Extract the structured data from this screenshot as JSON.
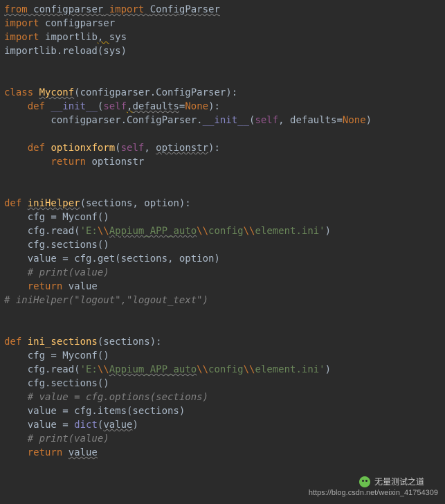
{
  "code": {
    "l1": {
      "a": "from ",
      "b": "configparser",
      "c": " import ",
      "d": "ConfigParser"
    },
    "l2": {
      "a": "import ",
      "b": "configparser"
    },
    "l3": {
      "a": "import ",
      "b": "importlib",
      "c": ", ",
      "d": "sys"
    },
    "l4": {
      "a": "importlib.reload(sys)"
    },
    "l5": "",
    "l6": "",
    "l7": {
      "a": "class ",
      "b": "Myconf",
      "c": "(configparser.ConfigParser):"
    },
    "l8": {
      "a": "    def ",
      "b": "__init__",
      "c": "(",
      "d": "self",
      "e": ",",
      "f": "defaults",
      "g": "=",
      "h": "None",
      "i": "):"
    },
    "l9": {
      "a": "        configparser.ConfigParser.",
      "b": "__init__",
      "c": "(",
      "d": "self",
      "e": ", ",
      "f": "defaults",
      "g": "=",
      "h": "None",
      "i": ")"
    },
    "l10": "",
    "l11": {
      "a": "    def ",
      "b": "optionxform",
      "c": "(",
      "d": "self",
      "e": ", ",
      "f": "optionstr",
      "g": "):"
    },
    "l12": {
      "a": "        return ",
      "b": "optionstr"
    },
    "l13": "",
    "l14": "",
    "l15": {
      "a": "def ",
      "b": "iniHelper",
      "c": "(sections, option):"
    },
    "l16": {
      "a": "    cfg = Myconf()"
    },
    "l17": {
      "a": "    cfg.read(",
      "b": "'E:",
      "c": "\\\\",
      "d": "Appium_APP_auto",
      "e": "\\\\",
      "f": "config",
      "g": "\\\\",
      "h": "element.ini'",
      "i": ")"
    },
    "l18": {
      "a": "    cfg.sections()"
    },
    "l19": {
      "a": "    value = cfg.get(sections, option)"
    },
    "l20": {
      "a": "    # print(value)"
    },
    "l21": {
      "a": "    return ",
      "b": "value"
    },
    "l22": {
      "a": "# iniHelper(\"logout\",\"logout_text\")"
    },
    "l23": "",
    "l24": "",
    "l25": {
      "a": "def ",
      "b": "ini_sections",
      "c": "(sections):"
    },
    "l26": {
      "a": "    cfg = Myconf()"
    },
    "l27": {
      "a": "    cfg.read(",
      "b": "'E:",
      "c": "\\\\",
      "d": "Appium_APP_auto",
      "e": "\\\\",
      "f": "config",
      "g": "\\\\",
      "h": "element.ini'",
      "i": ")"
    },
    "l28": {
      "a": "    cfg.sections()"
    },
    "l29": {
      "a": "    # value = cfg.options(sections)"
    },
    "l30": {
      "a": "    value = cfg.items(sections)"
    },
    "l31": {
      "a": "    value = ",
      "b": "dict",
      "c": "(",
      "d": "value",
      "e": ")"
    },
    "l32": {
      "a": "    # print(value)"
    },
    "l33": {
      "a": "    return ",
      "b": "value"
    }
  },
  "footer": {
    "wechat_label": "无量测试之道",
    "watermark": "https://blog.csdn.net/weixin_41754309"
  }
}
